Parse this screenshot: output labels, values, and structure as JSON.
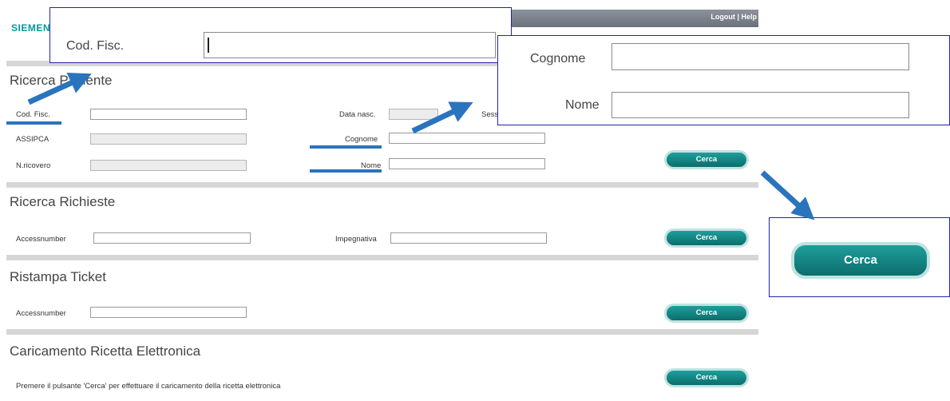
{
  "header": {
    "logo_text": "SIEMENS",
    "logout_label": "Logout",
    "link_sep": "|",
    "help_label": "Help"
  },
  "ricerca_paziente": {
    "title": "Ricerca Paziente",
    "cod_fisc_label": "Cod. Fisc.",
    "assipca_label": "ASSIPCA",
    "nricovero_label": "N.ricovero",
    "data_nasc_label": "Data nasc.",
    "sesso_label": "Sesso",
    "cognome_label": "Cognome",
    "nome_label": "Nome",
    "cerca_label": "Cerca"
  },
  "ricerca_richieste": {
    "title": "Ricerca Richieste",
    "accessnumber_label": "Accessnumber",
    "impegnativa_label": "Impegnativa",
    "cerca_label": "Cerca"
  },
  "ristampa_ticket": {
    "title": "Ristampa Ticket",
    "accessnumber_label": "Accessnumber",
    "cerca_label": "Cerca"
  },
  "ricetta": {
    "title": "Caricamento Ricetta Elettronica",
    "info_text": "Premere il pulsante 'Cerca' per effettuare il caricamento della ricetta elettronica",
    "cerca_label": "Cerca"
  },
  "callouts": {
    "codfisc_label": "Cod. Fisc.",
    "cognome_label": "Cognome",
    "nome_label": "Nome",
    "cerca_label": "Cerca"
  },
  "colors": {
    "accent_teal": "#0b6e6c",
    "annotation_blue": "#2a74bd",
    "callout_border": "#2222aa"
  }
}
